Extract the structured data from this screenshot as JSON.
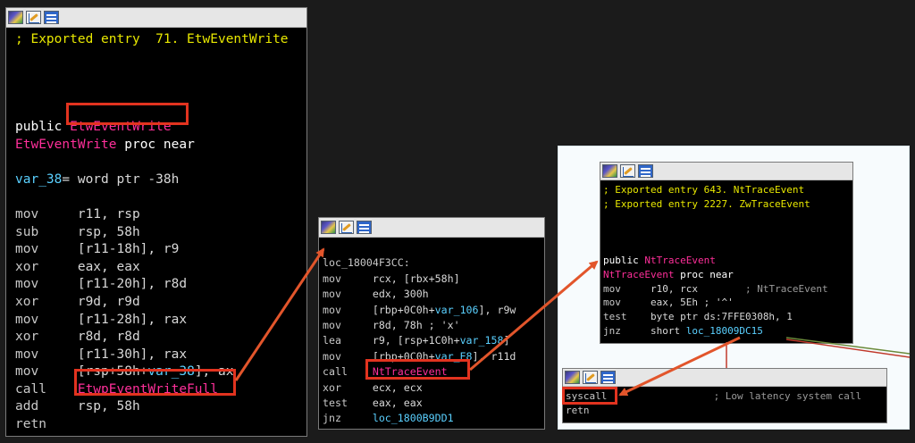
{
  "panel1": {
    "titlebar_icons": [
      "graph-icon",
      "edit-icon",
      "list-icon"
    ],
    "lines": [
      {
        "tokens": [
          {
            "cls": "cm",
            "t": "; Exported entry  71. EtwEventWrite"
          }
        ]
      },
      {
        "tokens": []
      },
      {
        "tokens": []
      },
      {
        "tokens": []
      },
      {
        "tokens": []
      },
      {
        "tokens": [
          {
            "cls": "pub",
            "t": "public "
          },
          {
            "cls": "fn",
            "t": "EtwEventWrite"
          }
        ]
      },
      {
        "tokens": [
          {
            "cls": "fn",
            "t": "EtwEventWrite"
          },
          {
            "cls": "pub",
            "t": " proc near"
          }
        ]
      },
      {
        "tokens": []
      },
      {
        "tokens": [
          {
            "cls": "var",
            "t": "var_38"
          },
          {
            "cls": "op",
            "t": "= word ptr -38h"
          }
        ]
      },
      {
        "tokens": []
      },
      {
        "tokens": [
          {
            "cls": "mn",
            "t": "mov     "
          },
          {
            "cls": "op",
            "t": "r11, rsp"
          }
        ]
      },
      {
        "tokens": [
          {
            "cls": "mn",
            "t": "sub     "
          },
          {
            "cls": "op",
            "t": "rsp, 58h"
          }
        ]
      },
      {
        "tokens": [
          {
            "cls": "mn",
            "t": "mov     "
          },
          {
            "cls": "op",
            "t": "[r11-18h], r9"
          }
        ]
      },
      {
        "tokens": [
          {
            "cls": "mn",
            "t": "xor     "
          },
          {
            "cls": "op",
            "t": "eax, eax"
          }
        ]
      },
      {
        "tokens": [
          {
            "cls": "mn",
            "t": "mov     "
          },
          {
            "cls": "op",
            "t": "[r11-20h], r8d"
          }
        ]
      },
      {
        "tokens": [
          {
            "cls": "mn",
            "t": "xor     "
          },
          {
            "cls": "op",
            "t": "r9d, r9d"
          }
        ]
      },
      {
        "tokens": [
          {
            "cls": "mn",
            "t": "mov     "
          },
          {
            "cls": "op",
            "t": "[r11-28h], rax"
          }
        ]
      },
      {
        "tokens": [
          {
            "cls": "mn",
            "t": "xor     "
          },
          {
            "cls": "op",
            "t": "r8d, r8d"
          }
        ]
      },
      {
        "tokens": [
          {
            "cls": "mn",
            "t": "mov     "
          },
          {
            "cls": "op",
            "t": "[r11-30h], rax"
          }
        ]
      },
      {
        "tokens": [
          {
            "cls": "mn",
            "t": "mov     "
          },
          {
            "cls": "op",
            "t": "[rsp+58h+"
          },
          {
            "cls": "var",
            "t": "var_38"
          },
          {
            "cls": "op",
            "t": "], ax"
          }
        ]
      },
      {
        "tokens": [
          {
            "cls": "mn",
            "t": "call    "
          },
          {
            "cls": "fn",
            "t": "EtwpEventWriteFull"
          }
        ]
      },
      {
        "tokens": [
          {
            "cls": "mn",
            "t": "add     "
          },
          {
            "cls": "op",
            "t": "rsp, 58h"
          }
        ]
      },
      {
        "tokens": [
          {
            "cls": "mn",
            "t": "retn"
          }
        ]
      }
    ]
  },
  "panel2": {
    "titlebar_icons": [
      "graph-icon",
      "edit-icon",
      "list-icon"
    ],
    "lines": [
      {
        "tokens": []
      },
      {
        "tokens": [
          {
            "cls": "lbl",
            "t": "loc_18004F3CC:"
          }
        ]
      },
      {
        "tokens": [
          {
            "cls": "mn",
            "t": "mov     "
          },
          {
            "cls": "op",
            "t": "rcx, [rbx+58h]"
          }
        ]
      },
      {
        "tokens": [
          {
            "cls": "mn",
            "t": "mov     "
          },
          {
            "cls": "op",
            "t": "edx, 300h"
          }
        ]
      },
      {
        "tokens": [
          {
            "cls": "mn",
            "t": "mov     "
          },
          {
            "cls": "op",
            "t": "[rbp+0C0h+"
          },
          {
            "cls": "var",
            "t": "var_106"
          },
          {
            "cls": "op",
            "t": "], r9w"
          }
        ]
      },
      {
        "tokens": [
          {
            "cls": "mn",
            "t": "mov     "
          },
          {
            "cls": "op",
            "t": "r8d, 78h ; 'x'"
          }
        ]
      },
      {
        "tokens": [
          {
            "cls": "mn",
            "t": "lea     "
          },
          {
            "cls": "op",
            "t": "r9, [rsp+1C0h+"
          },
          {
            "cls": "var",
            "t": "var_158"
          },
          {
            "cls": "op",
            "t": "]"
          }
        ]
      },
      {
        "tokens": [
          {
            "cls": "mn",
            "t": "mov     "
          },
          {
            "cls": "op",
            "t": "[rbp+0C0h+"
          },
          {
            "cls": "var",
            "t": "var_E8"
          },
          {
            "cls": "op",
            "t": "], r11d"
          }
        ]
      },
      {
        "tokens": [
          {
            "cls": "mn",
            "t": "call    "
          },
          {
            "cls": "fn",
            "t": "NtTraceEvent"
          }
        ]
      },
      {
        "tokens": [
          {
            "cls": "mn",
            "t": "xor     "
          },
          {
            "cls": "op",
            "t": "ecx, ecx"
          }
        ]
      },
      {
        "tokens": [
          {
            "cls": "mn",
            "t": "test    "
          },
          {
            "cls": "op",
            "t": "eax, eax"
          }
        ]
      },
      {
        "tokens": [
          {
            "cls": "mn",
            "t": "jnz     "
          },
          {
            "cls": "var",
            "t": "loc_1800B9DD1"
          }
        ]
      }
    ]
  },
  "panel3": {
    "titlebar_icons": [
      "graph-icon",
      "edit-icon",
      "list-icon"
    ],
    "lines": [
      {
        "tokens": [
          {
            "cls": "cm",
            "t": "; Exported entry 643. NtTraceEvent"
          }
        ]
      },
      {
        "tokens": [
          {
            "cls": "cm",
            "t": "; Exported entry 2227. ZwTraceEvent"
          }
        ]
      },
      {
        "tokens": []
      },
      {
        "tokens": []
      },
      {
        "tokens": []
      },
      {
        "tokens": [
          {
            "cls": "pub",
            "t": "public "
          },
          {
            "cls": "fn",
            "t": "NtTraceEvent"
          }
        ]
      },
      {
        "tokens": [
          {
            "cls": "fn",
            "t": "NtTraceEvent"
          },
          {
            "cls": "pub",
            "t": " proc near"
          }
        ]
      },
      {
        "tokens": [
          {
            "cls": "mn",
            "t": "mov     "
          },
          {
            "cls": "op",
            "t": "r10, rcx        "
          },
          {
            "cls": "cmg",
            "t": "; NtTraceEvent"
          }
        ]
      },
      {
        "tokens": [
          {
            "cls": "mn",
            "t": "mov     "
          },
          {
            "cls": "op",
            "t": "eax, 5Eh ; '^'"
          }
        ]
      },
      {
        "tokens": [
          {
            "cls": "mn",
            "t": "test    "
          },
          {
            "cls": "op",
            "t": "byte ptr ds:7FFE0308h, 1"
          }
        ]
      },
      {
        "tokens": [
          {
            "cls": "mn",
            "t": "jnz     "
          },
          {
            "cls": "op",
            "t": "short "
          },
          {
            "cls": "var",
            "t": "loc_18009DC15"
          }
        ]
      }
    ]
  },
  "panel4": {
    "titlebar_icons": [
      "graph-icon",
      "edit-icon",
      "list-icon"
    ],
    "lines": [
      {
        "tokens": [
          {
            "cls": "mn",
            "t": "syscall"
          },
          {
            "cls": "cmg",
            "t": "                  ; Low latency system call"
          }
        ]
      },
      {
        "tokens": [
          {
            "cls": "mn",
            "t": "retn"
          }
        ]
      }
    ]
  },
  "colors": {
    "highlight": "#e2331f",
    "function_name": "#ff2f9a",
    "comment": "#e8e800",
    "variable": "#5ad0ff"
  }
}
